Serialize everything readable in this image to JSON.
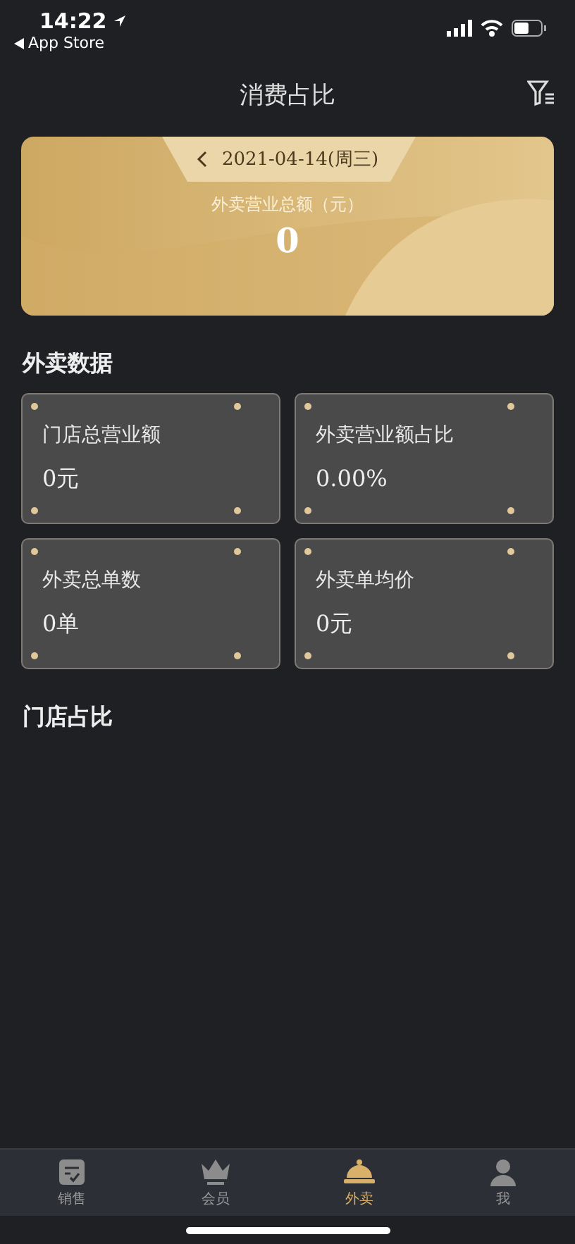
{
  "status_bar": {
    "time": "14:22",
    "back_label": "App Store"
  },
  "nav": {
    "title": "消费占比"
  },
  "summary": {
    "date": "2021-04-14(周三)",
    "label": "外卖营业总额（元）",
    "value": "0"
  },
  "sections": [
    {
      "title": "外卖数据",
      "stats": [
        {
          "label": "门店总营业额",
          "value": "0元"
        },
        {
          "label": "外卖营业额占比",
          "value": "0.00%"
        },
        {
          "label": "外卖总单数",
          "value": "0单"
        },
        {
          "label": "外卖单均价",
          "value": "0元"
        }
      ]
    },
    {
      "title": "门店占比"
    }
  ],
  "tabs": [
    {
      "label": "销售",
      "kind": "sales",
      "selected": false
    },
    {
      "label": "会员",
      "kind": "member",
      "selected": false
    },
    {
      "label": "外卖",
      "kind": "takeout",
      "selected": true
    },
    {
      "label": "我",
      "kind": "me",
      "selected": false
    }
  ]
}
